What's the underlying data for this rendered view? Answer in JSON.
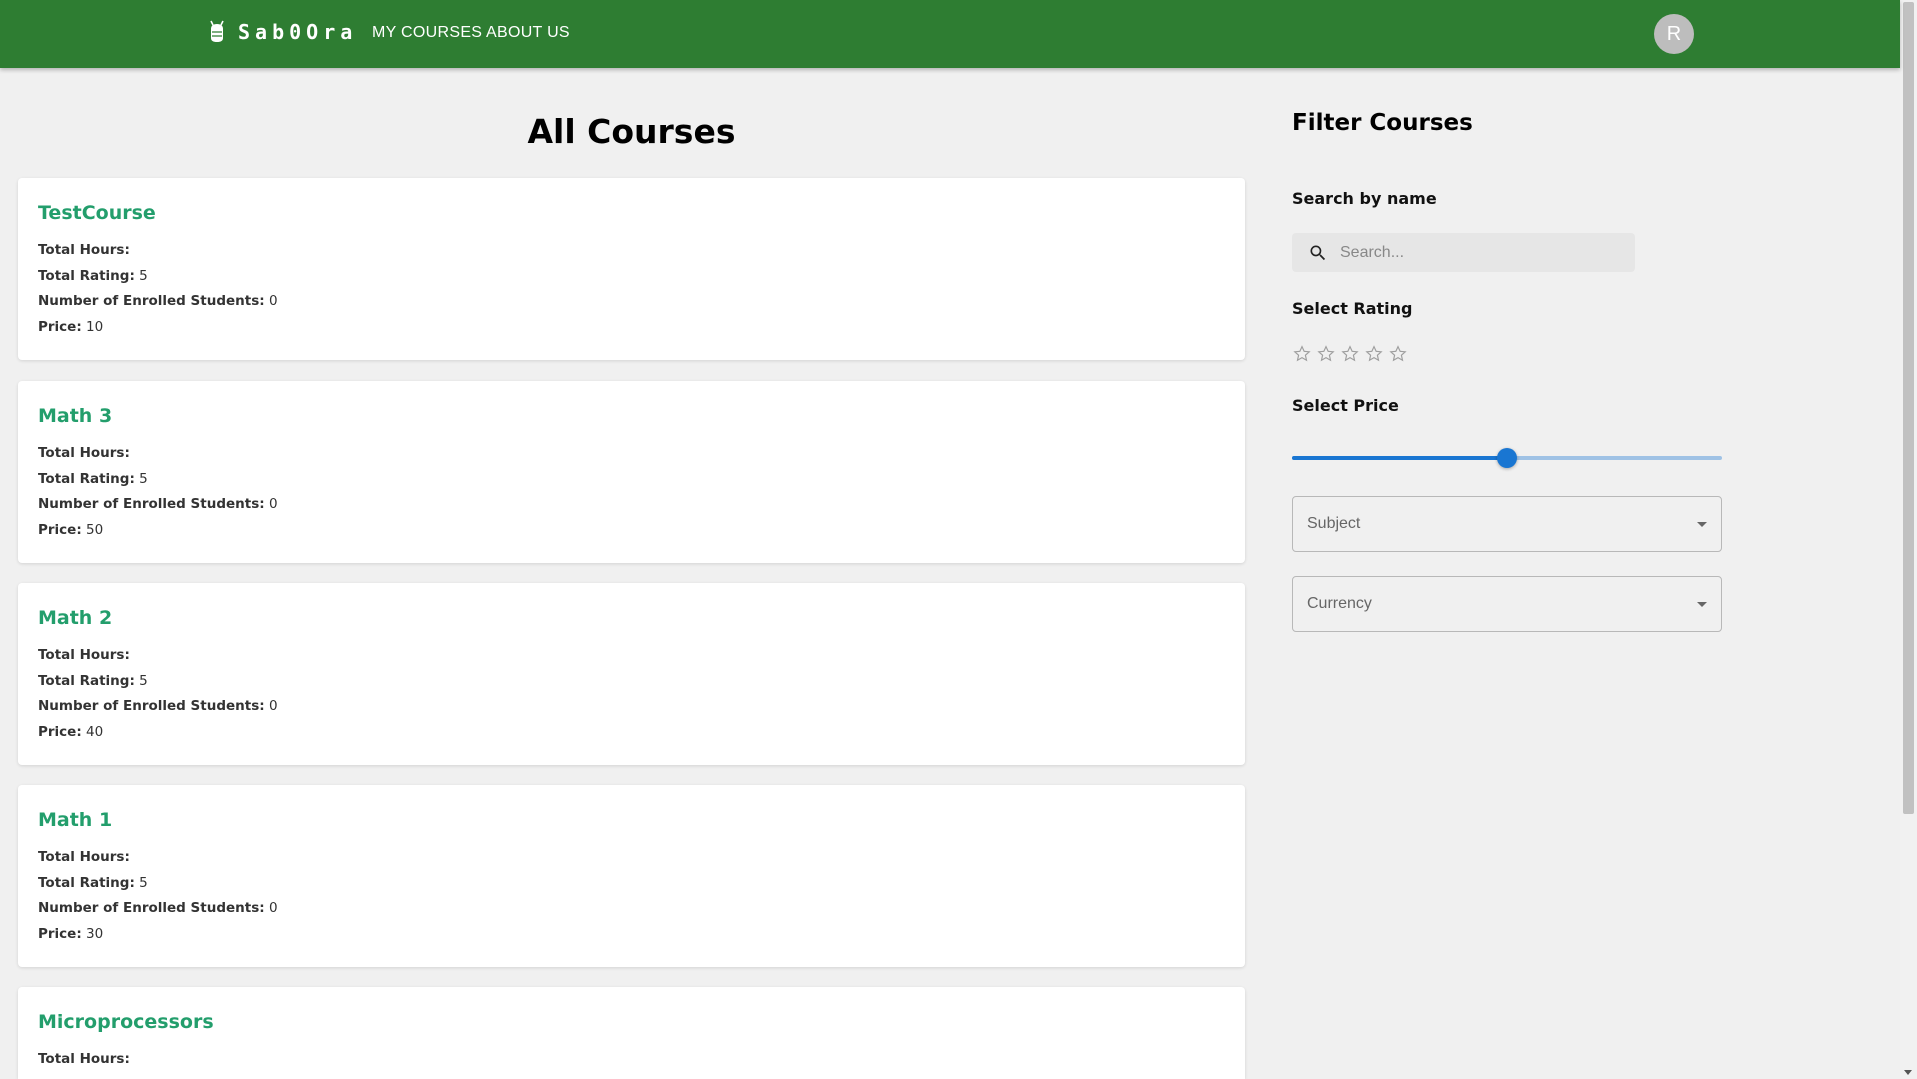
{
  "header": {
    "logo_text": "Sab0Ora",
    "nav": [
      "MY COURSES",
      "ABOUT US"
    ],
    "avatar_letter": "R",
    "color": "#2e7d32"
  },
  "main": {
    "title": "All Courses",
    "field_labels": {
      "hours": "Total Hours:",
      "rating": "Total Rating:",
      "students": "Number of Enrolled Students:",
      "price": "Price:"
    },
    "courses": [
      {
        "name": "TestCourse",
        "hours": "",
        "rating": "5",
        "students": "0",
        "price": "10"
      },
      {
        "name": "Math 3",
        "hours": "",
        "rating": "5",
        "students": "0",
        "price": "50"
      },
      {
        "name": "Math 2",
        "hours": "",
        "rating": "5",
        "students": "0",
        "price": "40"
      },
      {
        "name": "Math 1",
        "hours": "",
        "rating": "5",
        "students": "0",
        "price": "30"
      },
      {
        "name": "Microprocessors",
        "hours": "",
        "rating": "",
        "students": "",
        "price": ""
      }
    ],
    "course_name_color": "#239e6c"
  },
  "filter": {
    "title": "Filter Courses",
    "search_label": "Search by name",
    "search_placeholder": "Search...",
    "rating_label": "Select Rating",
    "rating_value": 0,
    "rating_max": 5,
    "price_label": "Select Price",
    "price_slider_fraction": 0.5,
    "subject_label": "Subject",
    "currency_label": "Currency",
    "accent_color": "#1976d2"
  }
}
